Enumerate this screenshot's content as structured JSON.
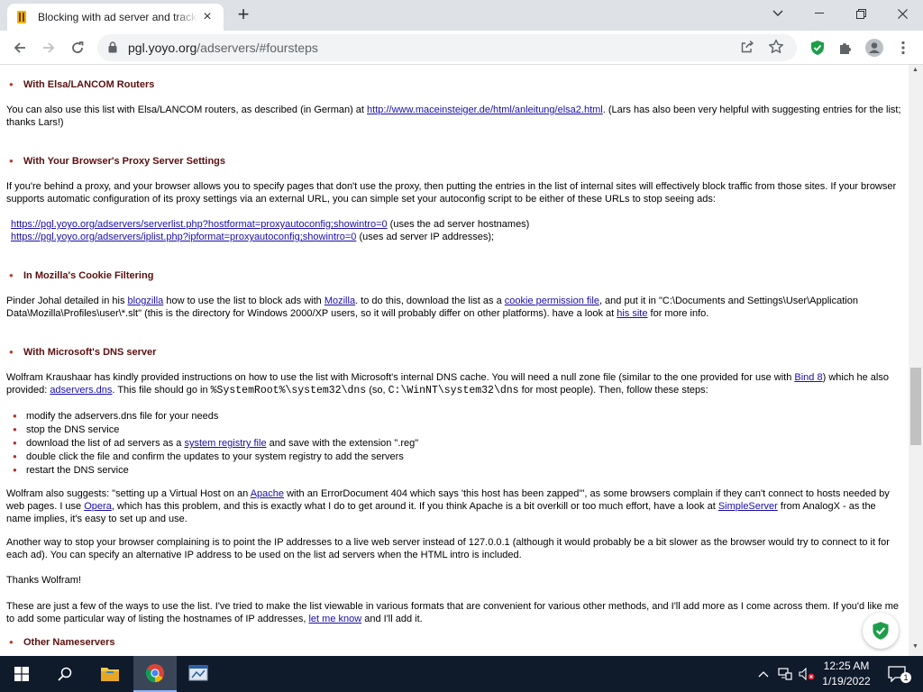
{
  "browser": {
    "tab_title": "Blocking with ad server and tracking server hostnames",
    "tab_close": "×",
    "new_tab": "+",
    "url_host": "pgl.yoyo.org",
    "url_path": "/adservers/#foursteps"
  },
  "content": {
    "sections": {
      "elsa": {
        "heading": "With Elsa/LANCOM Routers",
        "text_before": "You can also use this list with Elsa/LANCOM routers, as described (in German) at ",
        "link": "http://www.maceinsteiger.de/html/anleitung/elsa2.html",
        "text_after": ". (Lars has also been very helpful with suggesting entries for the list; thanks Lars!)"
      },
      "proxy": {
        "heading": "With Your Browser's Proxy Server Settings",
        "text": "If you're behind a proxy, and your browser allows you to specify pages that don't use the proxy, then putting the entries in the list of internal sites will effectively block traffic from those sites. If your browser supports automatic configuration of its proxy settings via an external URL, you can simple set your autoconfig script to be either of these URLs to stop seeing ads:",
        "link1": "https://pgl.yoyo.org/adservers/serverlist.php?hostformat=proxyautoconfig;showintro=0",
        "link1_note": " (uses the ad server hostnames)",
        "link2": "https://pgl.yoyo.org/adservers/iplist.php?ipformat=proxyautoconfig;showintro=0",
        "link2_note": " (uses ad server IP addresses);"
      },
      "mozilla": {
        "heading": "In Mozilla's Cookie Filtering",
        "t1": "Pinder Johal detailed in his ",
        "l1": "blogzilla",
        "t2": " how to use the list to block ads with ",
        "l2": "Mozilla",
        "t3": ". to do this, download the list as a ",
        "l3": "cookie permission file",
        "t4": ", and put it in \"C:\\Documents and Settings\\User\\Application Data\\Mozilla\\Profiles\\user\\*.slt\" (this is the directory for Windows 2000/XP users, so it will probably differ on other platforms). have a look at ",
        "l4": "his site",
        "t5": " for more info."
      },
      "dns": {
        "heading": "With Microsoft's DNS server",
        "t1": "Wolfram Kraushaar has kindly provided instructions on how to use the list with Microsoft's internal DNS cache. You will need a null zone file (similar to the one provided for use with ",
        "l1": "Bind 8",
        "t2": ") which he also provided: ",
        "l2": "adservers.dns",
        "t3": ". This file should go in ",
        "m1": "%SystemRoot%\\system32\\dns",
        "t4": " (so, ",
        "m2": "C:\\WinNT\\system32\\dns",
        "t5": " for most people). Then, follow these steps:",
        "steps": [
          "modify the adservers.dns file for your needs",
          "stop the DNS service",
          "download the list of ad servers as a ",
          "double click the file and confirm the updates to your system registry to add the servers",
          "restart the DNS service"
        ],
        "step3_link": "system registry file",
        "step3_after": " and save with the extension \".reg\"",
        "w1": "Wolfram also suggests: \"setting up a Virtual Host on an ",
        "wl1": "Apache",
        "w2": " with an ErrorDocument 404 which says 'this host has been zapped'\", as some browsers complain if they can't connect to hosts needed by web pages. I use ",
        "wl2": "Opera",
        "w3": ", which has this problem, and this is exactly what I do to get around it. If you think Apache is a bit overkill or too much effort, have a look at ",
        "wl3": "SimpleServer",
        "w4": " from AnalogX - as the name implies, it's easy to set up and use.",
        "another": "Another way to stop your browser complaining is to point the IP addresses to a live web server instead of 127.0.0.1 (although it would probably be a bit slower as the browser would try to connect to it for each ad). You can specify an alternative IP address to be used on the list ad servers when the HTML intro is included.",
        "thanks": "Thanks Wolfram!",
        "few1": "These are just a few of the ways to use the list. I've tried to make the list viewable in various formats that are convenient for various other methods, and I'll add more as I come across them. If you'd like me to add some particular way of listing the hostnames of IP addresses, ",
        "fewlink": "let me know",
        "few2": " and I'll add it."
      },
      "other": {
        "heading": "Other Nameservers"
      }
    }
  },
  "taskbar": {
    "time": "12:25 AM",
    "date": "1/19/2022",
    "notifications": "1"
  },
  "colors": {
    "heading": "#5a0f0f",
    "link": "#1a0dab",
    "taskbar": "#0f1a2b"
  }
}
